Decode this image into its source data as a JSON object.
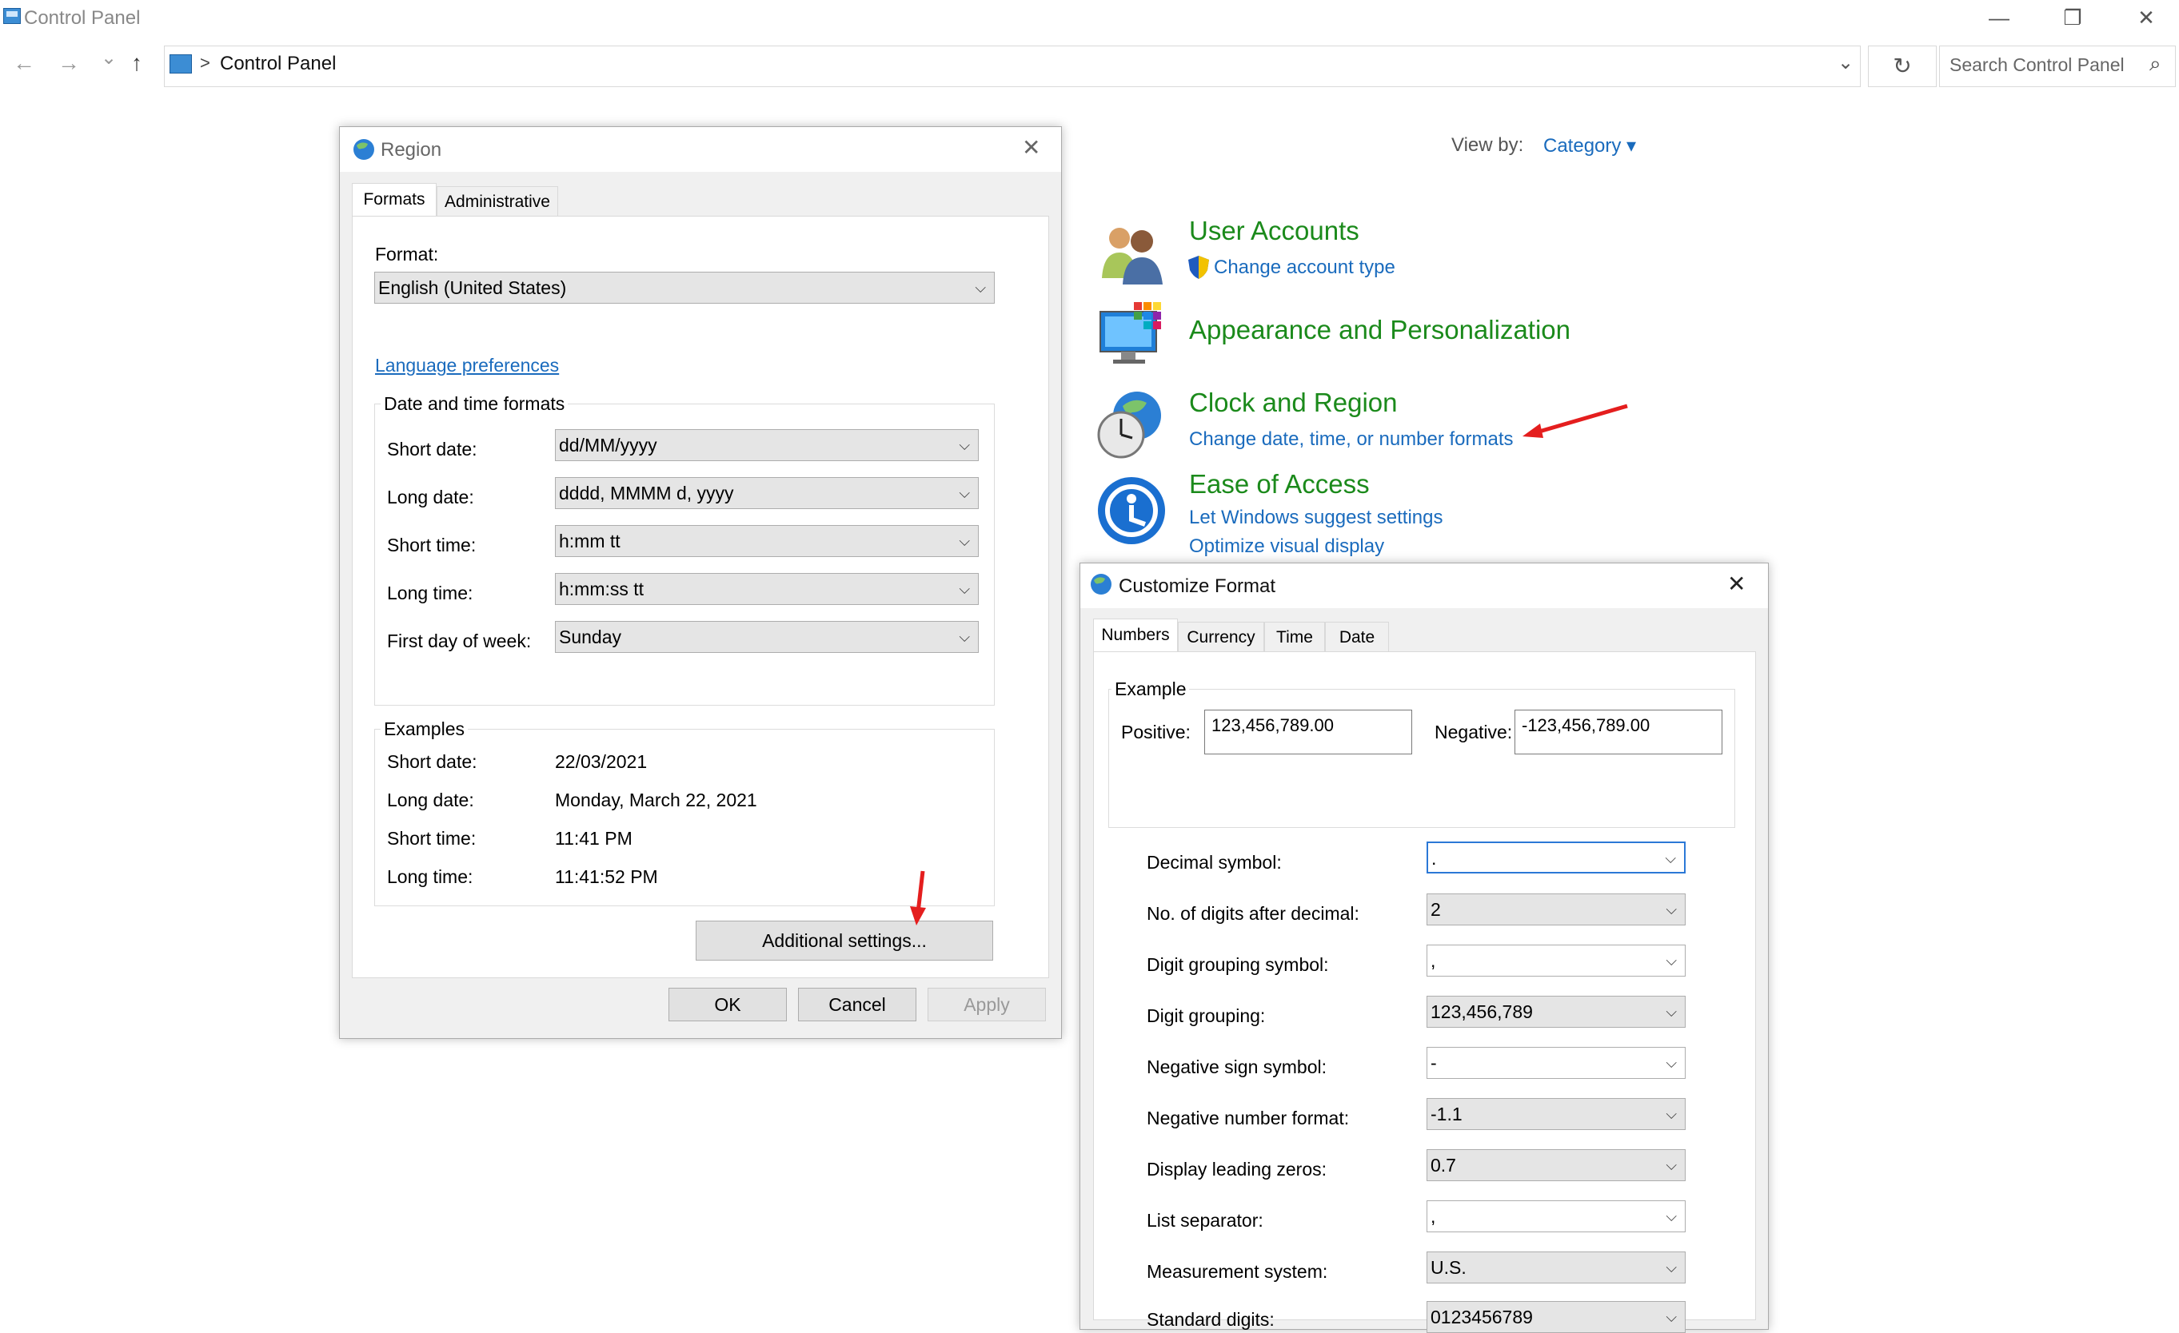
{
  "window": {
    "title": "Control Panel",
    "minimize": "—",
    "restore": "❐",
    "close": "✕"
  },
  "nav": {
    "back": "←",
    "forward": "→",
    "recent": "⌄",
    "up": "↑",
    "path_separator": ">",
    "path": "Control Panel",
    "dropdown": "⌄",
    "refresh": "↻",
    "search_placeholder": "Search Control Panel",
    "search_icon": "⌕"
  },
  "view_by": {
    "label": "View by:",
    "value": "Category ▾"
  },
  "categories": [
    {
      "title": "User Accounts",
      "links": [
        "Change account type"
      ]
    },
    {
      "title": "Appearance and Personalization",
      "links": []
    },
    {
      "title": "Clock and Region",
      "links": [
        "Change date, time, or number formats"
      ]
    },
    {
      "title": "Ease of Access",
      "links": [
        "Let Windows suggest settings",
        "Optimize visual display"
      ]
    }
  ],
  "region_dialog": {
    "title": "Region",
    "close": "✕",
    "tabs": [
      "Formats",
      "Administrative"
    ],
    "format_label": "Format:",
    "format_value": "English (United States)",
    "language_link": "Language preferences",
    "dt_group": "Date and time formats",
    "dt_rows": [
      {
        "label": "Short date:",
        "value": "dd/MM/yyyy"
      },
      {
        "label": "Long date:",
        "value": "dddd, MMMM d, yyyy"
      },
      {
        "label": "Short time:",
        "value": "h:mm tt"
      },
      {
        "label": "Long time:",
        "value": "h:mm:ss tt"
      },
      {
        "label": "First day of week:",
        "value": "Sunday"
      }
    ],
    "examples_group": "Examples",
    "examples": [
      {
        "label": "Short date:",
        "value": "22/03/2021"
      },
      {
        "label": "Long date:",
        "value": "Monday, March 22, 2021"
      },
      {
        "label": "Short time:",
        "value": "11:41 PM"
      },
      {
        "label": "Long time:",
        "value": "11:41:52 PM"
      }
    ],
    "additional_button": "Additional settings...",
    "ok": "OK",
    "cancel": "Cancel",
    "apply": "Apply"
  },
  "customize_dialog": {
    "title": "Customize Format",
    "close": "✕",
    "tabs": [
      "Numbers",
      "Currency",
      "Time",
      "Date"
    ],
    "example_label": "Example",
    "positive_label": "Positive:",
    "positive_value": "123,456,789.00",
    "negative_label": "Negative:",
    "negative_value": "-123,456,789.00",
    "settings": [
      {
        "label": "Decimal symbol:",
        "value": "."
      },
      {
        "label": "No. of digits after decimal:",
        "value": "2"
      },
      {
        "label": "Digit grouping symbol:",
        "value": ","
      },
      {
        "label": "Digit grouping:",
        "value": "123,456,789"
      },
      {
        "label": "Negative sign symbol:",
        "value": "-"
      },
      {
        "label": "Negative number format:",
        "value": "-1.1"
      },
      {
        "label": "Display leading zeros:",
        "value": "0.7"
      },
      {
        "label": "List separator:",
        "value": ","
      },
      {
        "label": "Measurement system:",
        "value": "U.S."
      },
      {
        "label": "Standard digits:",
        "value": "0123456789"
      }
    ]
  },
  "colors": {
    "category_title": "#1b8a1b",
    "link": "#1a6bbd",
    "annotation_arrow": "#e41e1e"
  }
}
